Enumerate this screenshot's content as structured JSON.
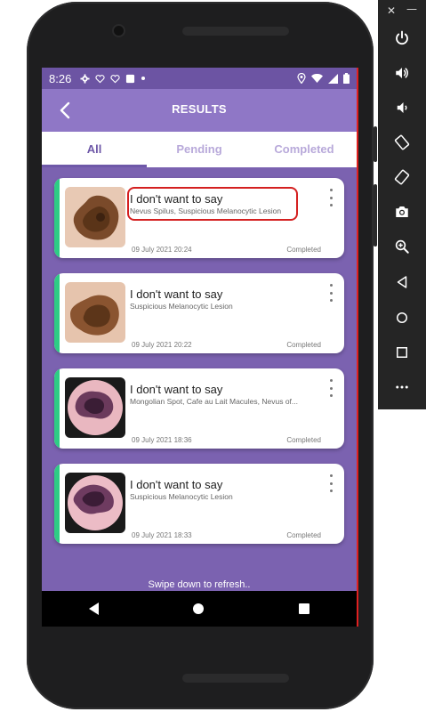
{
  "status_bar": {
    "time": "8:26"
  },
  "app_bar": {
    "title": "RESULTS",
    "back_icon": "arrow-back-icon"
  },
  "tabs": [
    {
      "label": "All",
      "active": true
    },
    {
      "label": "Pending",
      "active": false
    },
    {
      "label": "Completed",
      "active": false
    }
  ],
  "results": [
    {
      "title": "I don't want to say",
      "diagnosis": "Nevus Spilus, Suspicious Melanocytic Lesion",
      "date": "09 July 2021 20:24",
      "status": "Completed"
    },
    {
      "title": "I don't want to say",
      "diagnosis": "Suspicious Melanocytic Lesion",
      "date": "09 July 2021 20:22",
      "status": "Completed"
    },
    {
      "title": "I don't want to say",
      "diagnosis": "Mongolian Spot, Cafe au Lait Macules, Nevus of...",
      "date": "09 July 2021 18:36",
      "status": "Completed"
    },
    {
      "title": "I don't want to say",
      "diagnosis": "Suspicious Melanocytic Lesion",
      "date": "09 July 2021 18:33",
      "status": "Completed"
    }
  ],
  "footer": {
    "refresh_hint": "Swipe down to refresh.."
  },
  "colors": {
    "primary": "#8f77c6",
    "background": "#7b62b0",
    "accent_green": "#2ecc85",
    "highlight_red": "#d42020"
  }
}
